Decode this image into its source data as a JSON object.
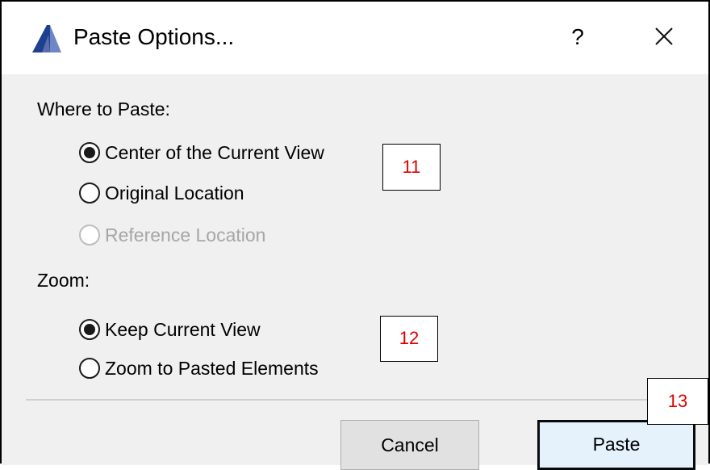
{
  "window": {
    "title": "Paste Options...",
    "help_label": "?",
    "icons": {
      "app": "archicad-icon",
      "close": "close-icon"
    }
  },
  "where_to_paste": {
    "label": "Where to Paste:",
    "options": [
      {
        "label": "Center of the Current View",
        "checked": true,
        "disabled": false
      },
      {
        "label": "Original Location",
        "checked": false,
        "disabled": false
      },
      {
        "label": "Reference Location",
        "checked": false,
        "disabled": true
      }
    ]
  },
  "zoom": {
    "label": "Zoom:",
    "options": [
      {
        "label": "Keep Current View",
        "checked": true,
        "disabled": false
      },
      {
        "label": "Zoom to Pasted Elements",
        "checked": false,
        "disabled": false
      }
    ]
  },
  "buttons": {
    "cancel": "Cancel",
    "paste": "Paste"
  },
  "callouts": [
    "11",
    "12",
    "13"
  ],
  "colors": {
    "callout_text": "#e00000",
    "default_button_bg": "#e5f1fb",
    "content_bg": "#f0f0f0"
  }
}
